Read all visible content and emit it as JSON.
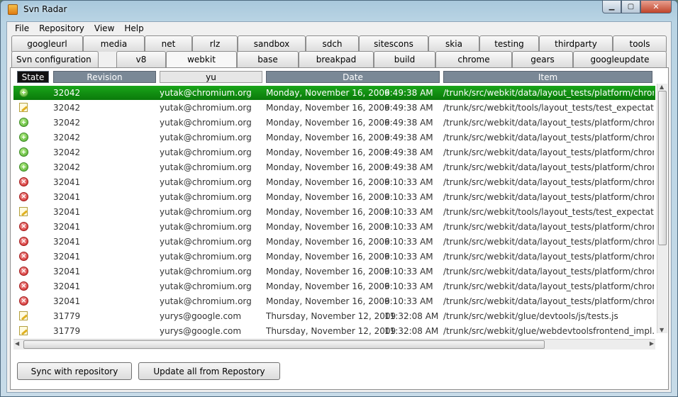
{
  "window": {
    "title": "Svn Radar"
  },
  "menu": [
    "File",
    "Repository",
    "View",
    "Help"
  ],
  "tabs_row1": [
    "googleurl",
    "media",
    "net",
    "rlz",
    "sandbox",
    "sdch",
    "sitescons",
    "skia",
    "testing",
    "thirdparty",
    "tools"
  ],
  "tabs_row2": [
    "Svn configuration",
    "v8",
    "webkit",
    "base",
    "breakpad",
    "build",
    "chrome",
    "gears",
    "googleupdate"
  ],
  "selected_tab": "webkit",
  "grid": {
    "headers": {
      "state": "State",
      "revision": "Revision",
      "author_filter": "yu",
      "date": "Date",
      "item": "Item"
    },
    "rows": [
      {
        "state": "added",
        "revision": "32042",
        "author": "yutak@chromium.org",
        "date": "Monday, November 16, 2009",
        "time": "6:49:38 AM",
        "item": "/trunk/src/webkit/data/layout_tests/platform/chromium"
      },
      {
        "state": "modified",
        "revision": "32042",
        "author": "yutak@chromium.org",
        "date": "Monday, November 16, 2009",
        "time": "6:49:38 AM",
        "item": "/trunk/src/webkit/tools/layout_tests/test_expectations.t"
      },
      {
        "state": "added",
        "revision": "32042",
        "author": "yutak@chromium.org",
        "date": "Monday, November 16, 2009",
        "time": "6:49:38 AM",
        "item": "/trunk/src/webkit/data/layout_tests/platform/chromium"
      },
      {
        "state": "added",
        "revision": "32042",
        "author": "yutak@chromium.org",
        "date": "Monday, November 16, 2009",
        "time": "6:49:38 AM",
        "item": "/trunk/src/webkit/data/layout_tests/platform/chromium"
      },
      {
        "state": "added",
        "revision": "32042",
        "author": "yutak@chromium.org",
        "date": "Monday, November 16, 2009",
        "time": "6:49:38 AM",
        "item": "/trunk/src/webkit/data/layout_tests/platform/chromium"
      },
      {
        "state": "added",
        "revision": "32042",
        "author": "yutak@chromium.org",
        "date": "Monday, November 16, 2009",
        "time": "6:49:38 AM",
        "item": "/trunk/src/webkit/data/layout_tests/platform/chromium"
      },
      {
        "state": "deleted",
        "revision": "32041",
        "author": "yutak@chromium.org",
        "date": "Monday, November 16, 2009",
        "time": "6:10:33 AM",
        "item": "/trunk/src/webkit/data/layout_tests/platform/chromium"
      },
      {
        "state": "deleted",
        "revision": "32041",
        "author": "yutak@chromium.org",
        "date": "Monday, November 16, 2009",
        "time": "6:10:33 AM",
        "item": "/trunk/src/webkit/data/layout_tests/platform/chromium"
      },
      {
        "state": "modified",
        "revision": "32041",
        "author": "yutak@chromium.org",
        "date": "Monday, November 16, 2009",
        "time": "6:10:33 AM",
        "item": "/trunk/src/webkit/tools/layout_tests/test_expectations.t"
      },
      {
        "state": "deleted",
        "revision": "32041",
        "author": "yutak@chromium.org",
        "date": "Monday, November 16, 2009",
        "time": "6:10:33 AM",
        "item": "/trunk/src/webkit/data/layout_tests/platform/chromium"
      },
      {
        "state": "deleted",
        "revision": "32041",
        "author": "yutak@chromium.org",
        "date": "Monday, November 16, 2009",
        "time": "6:10:33 AM",
        "item": "/trunk/src/webkit/data/layout_tests/platform/chromium"
      },
      {
        "state": "deleted",
        "revision": "32041",
        "author": "yutak@chromium.org",
        "date": "Monday, November 16, 2009",
        "time": "6:10:33 AM",
        "item": "/trunk/src/webkit/data/layout_tests/platform/chromium"
      },
      {
        "state": "deleted",
        "revision": "32041",
        "author": "yutak@chromium.org",
        "date": "Monday, November 16, 2009",
        "time": "6:10:33 AM",
        "item": "/trunk/src/webkit/data/layout_tests/platform/chromium"
      },
      {
        "state": "deleted",
        "revision": "32041",
        "author": "yutak@chromium.org",
        "date": "Monday, November 16, 2009",
        "time": "6:10:33 AM",
        "item": "/trunk/src/webkit/data/layout_tests/platform/chromium"
      },
      {
        "state": "deleted",
        "revision": "32041",
        "author": "yutak@chromium.org",
        "date": "Monday, November 16, 2009",
        "time": "6:10:33 AM",
        "item": "/trunk/src/webkit/data/layout_tests/platform/chromium"
      },
      {
        "state": "modified",
        "revision": "31779",
        "author": "yurys@google.com",
        "date": "Thursday, November 12, 2009",
        "time": "11:32:08 AM",
        "item": "/trunk/src/webkit/glue/devtools/js/tests.js"
      },
      {
        "state": "modified",
        "revision": "31779",
        "author": "yurys@google.com",
        "date": "Thursday, November 12, 2009",
        "time": "11:32:08 AM",
        "item": "/trunk/src/webkit/glue/webdevtoolsfrontend_impl.cc"
      }
    ]
  },
  "buttons": {
    "sync": "Sync with repository",
    "update_all": "Update all from Repostory"
  },
  "colors": {
    "selected_row": "#109010",
    "header": "#7a8896"
  }
}
